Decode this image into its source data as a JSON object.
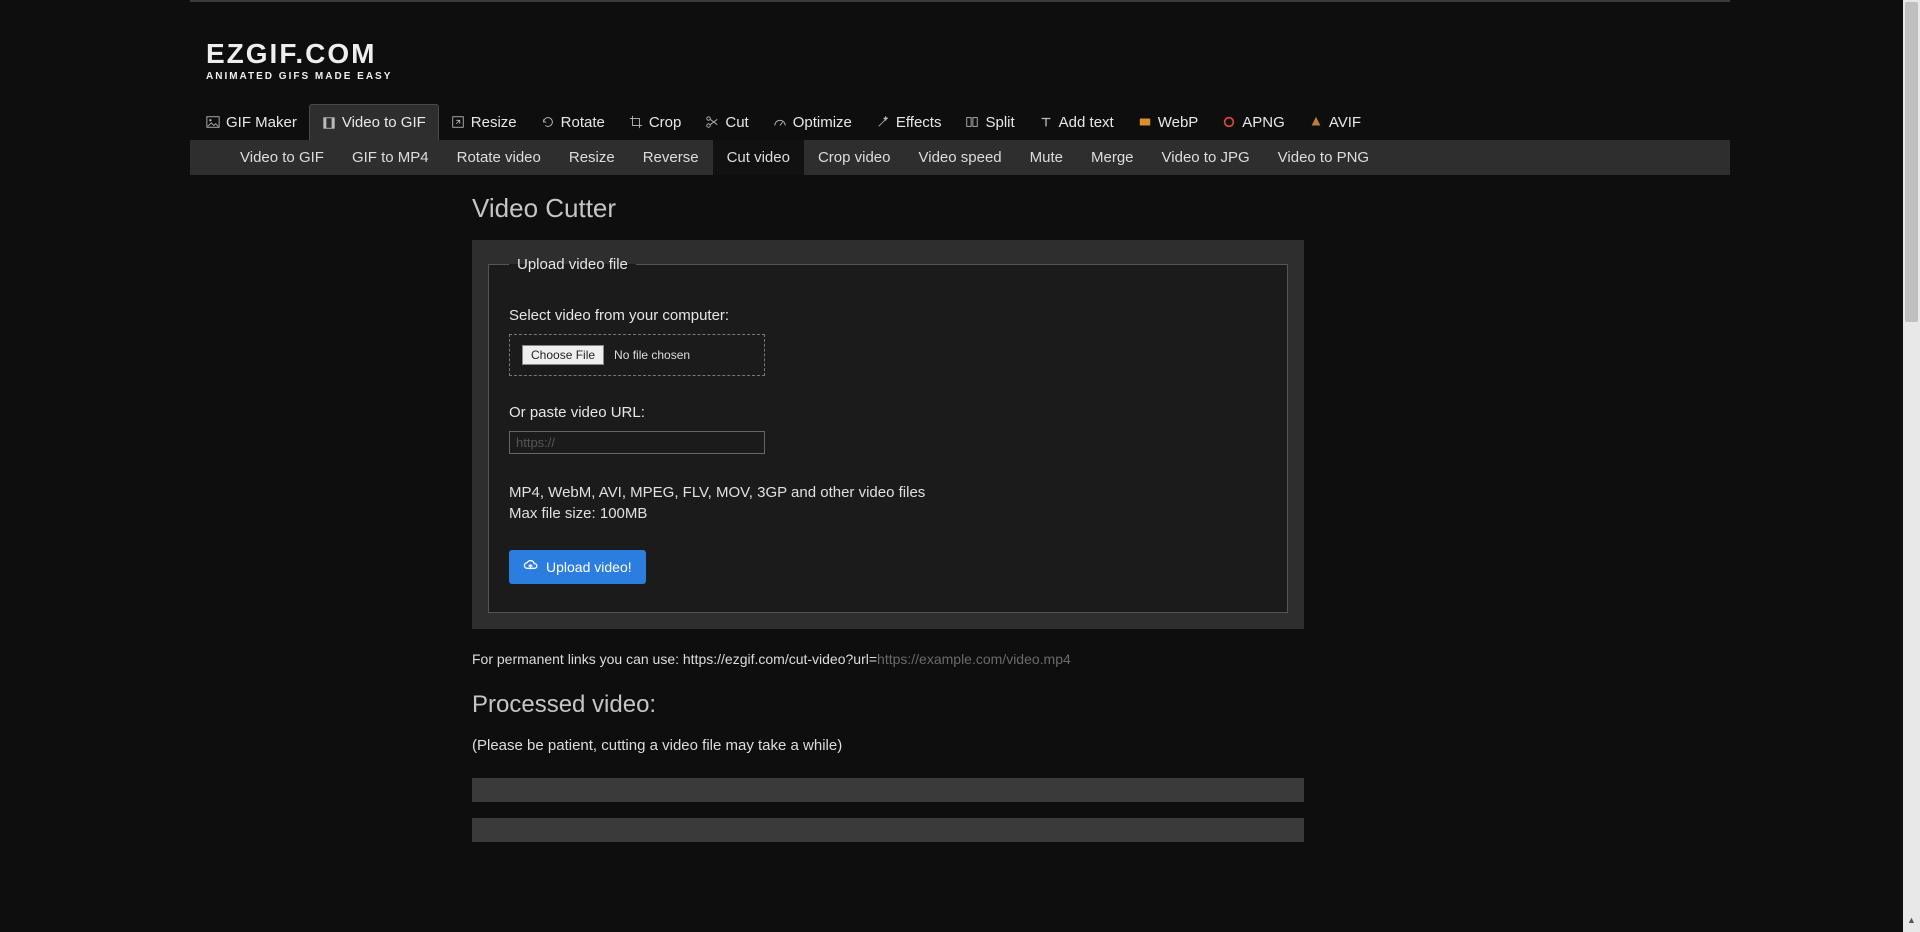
{
  "logo": {
    "main": "EZGIF.COM",
    "sub": "ANIMATED GIFS MADE EASY"
  },
  "nav_primary": [
    {
      "label": "GIF Maker",
      "icon": "image"
    },
    {
      "label": "Video to GIF",
      "icon": "film",
      "active": true
    },
    {
      "label": "Resize",
      "icon": "resize"
    },
    {
      "label": "Rotate",
      "icon": "rotate"
    },
    {
      "label": "Crop",
      "icon": "crop"
    },
    {
      "label": "Cut",
      "icon": "scissors"
    },
    {
      "label": "Optimize",
      "icon": "gauge"
    },
    {
      "label": "Effects",
      "icon": "wand"
    },
    {
      "label": "Split",
      "icon": "split"
    },
    {
      "label": "Add text",
      "icon": "text"
    },
    {
      "label": "WebP",
      "icon": "webp"
    },
    {
      "label": "APNG",
      "icon": "apng"
    },
    {
      "label": "AVIF",
      "icon": "avif"
    }
  ],
  "nav_secondary": [
    {
      "label": "Video to GIF"
    },
    {
      "label": "GIF to MP4"
    },
    {
      "label": "Rotate video"
    },
    {
      "label": "Resize"
    },
    {
      "label": "Reverse"
    },
    {
      "label": "Cut video",
      "active": true
    },
    {
      "label": "Crop video"
    },
    {
      "label": "Video speed"
    },
    {
      "label": "Mute"
    },
    {
      "label": "Merge"
    },
    {
      "label": "Video to JPG"
    },
    {
      "label": "Video to PNG"
    }
  ],
  "page_title": "Video Cutter",
  "upload": {
    "legend": "Upload video file",
    "select_label": "Select video from your computer:",
    "choose_btn": "Choose File",
    "no_file": "No file chosen",
    "url_label": "Or paste video URL:",
    "url_placeholder": "https://",
    "format_hint": "MP4, WebM, AVI, MPEG, FLV, MOV, 3GP and other video files",
    "size_hint": "Max file size: 100MB",
    "submit": "Upload video!"
  },
  "permalink": {
    "prefix": "For permanent links you can use: https://ezgif.com/cut-video?url=",
    "example": "https://example.com/video.mp4"
  },
  "processed": {
    "heading": "Processed video:",
    "note": "(Please be patient, cutting a video file may take a while)"
  }
}
